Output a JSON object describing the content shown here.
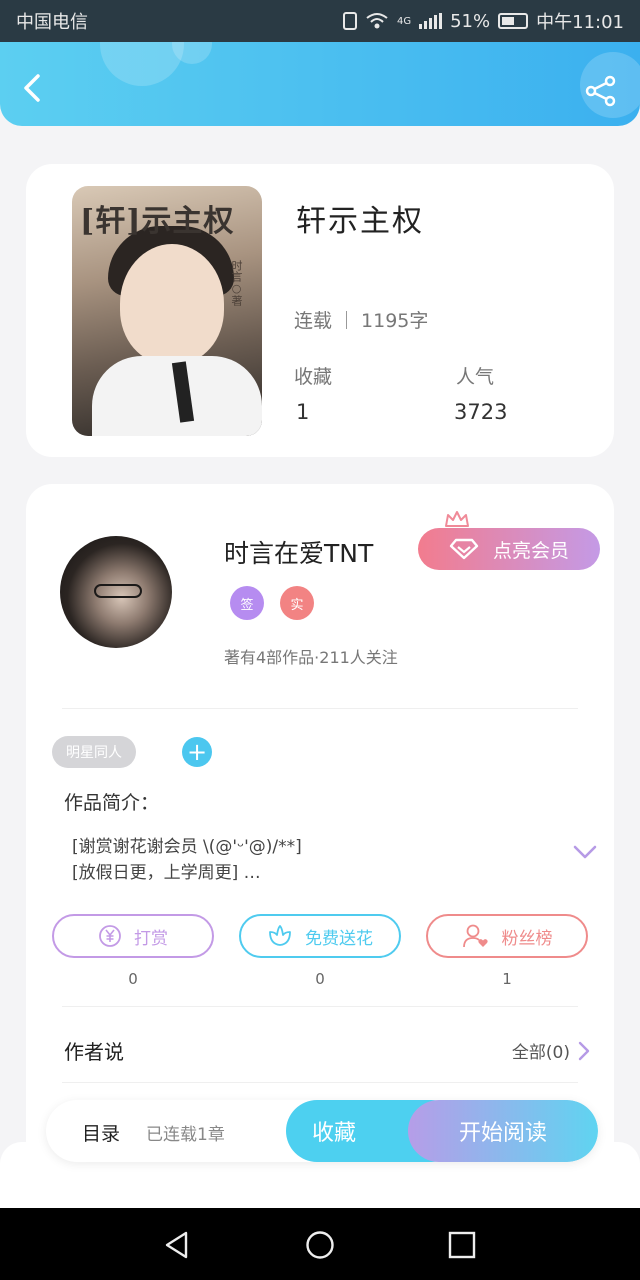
{
  "status_bar": {
    "carrier": "中国电信",
    "network": "4G",
    "battery": "51%",
    "time": "中午11:01"
  },
  "book": {
    "cover_title": "[轩]示主权",
    "cover_author": "时言○著",
    "title": "轩示主权",
    "status": "连载",
    "word_count": "1195字",
    "stats": [
      {
        "label": "收藏",
        "value": "1"
      },
      {
        "label": "人气",
        "value": "3723"
      }
    ]
  },
  "author": {
    "name": "时言在爱TNT",
    "vip_label": "点亮会员",
    "badges": [
      {
        "text": "签",
        "color": "#b68cf0"
      },
      {
        "text": "实",
        "color": "#f28383"
      }
    ],
    "info": "著有4部作品·211人关注"
  },
  "tags": [
    "明星同人"
  ],
  "intro": {
    "title": "作品简介：",
    "body": "[谢赏谢花谢会员 \\(@'ᵕ'@)/**]\n[放假日更，上学周更] …"
  },
  "actions": [
    {
      "label": "打赏",
      "count": "0",
      "color": "#c39ae6",
      "icon": "yen-icon"
    },
    {
      "label": "免费送花",
      "count": "0",
      "color": "#4fcbef",
      "icon": "flower-icon"
    },
    {
      "label": "粉丝榜",
      "count": "1",
      "color": "#ef8b8b",
      "icon": "fan-ranking-icon"
    }
  ],
  "author_said": {
    "title": "作者说",
    "all_label": "全部(0)"
  },
  "bottom_bar": {
    "toc_label": "目录",
    "chapter_info": "已连载1章",
    "collect_label": "收藏",
    "read_label": "开始阅读"
  },
  "colors": {
    "header_start": "#5ccff1",
    "header_end": "#3bb0ef",
    "accent": "#4cc7ef"
  }
}
